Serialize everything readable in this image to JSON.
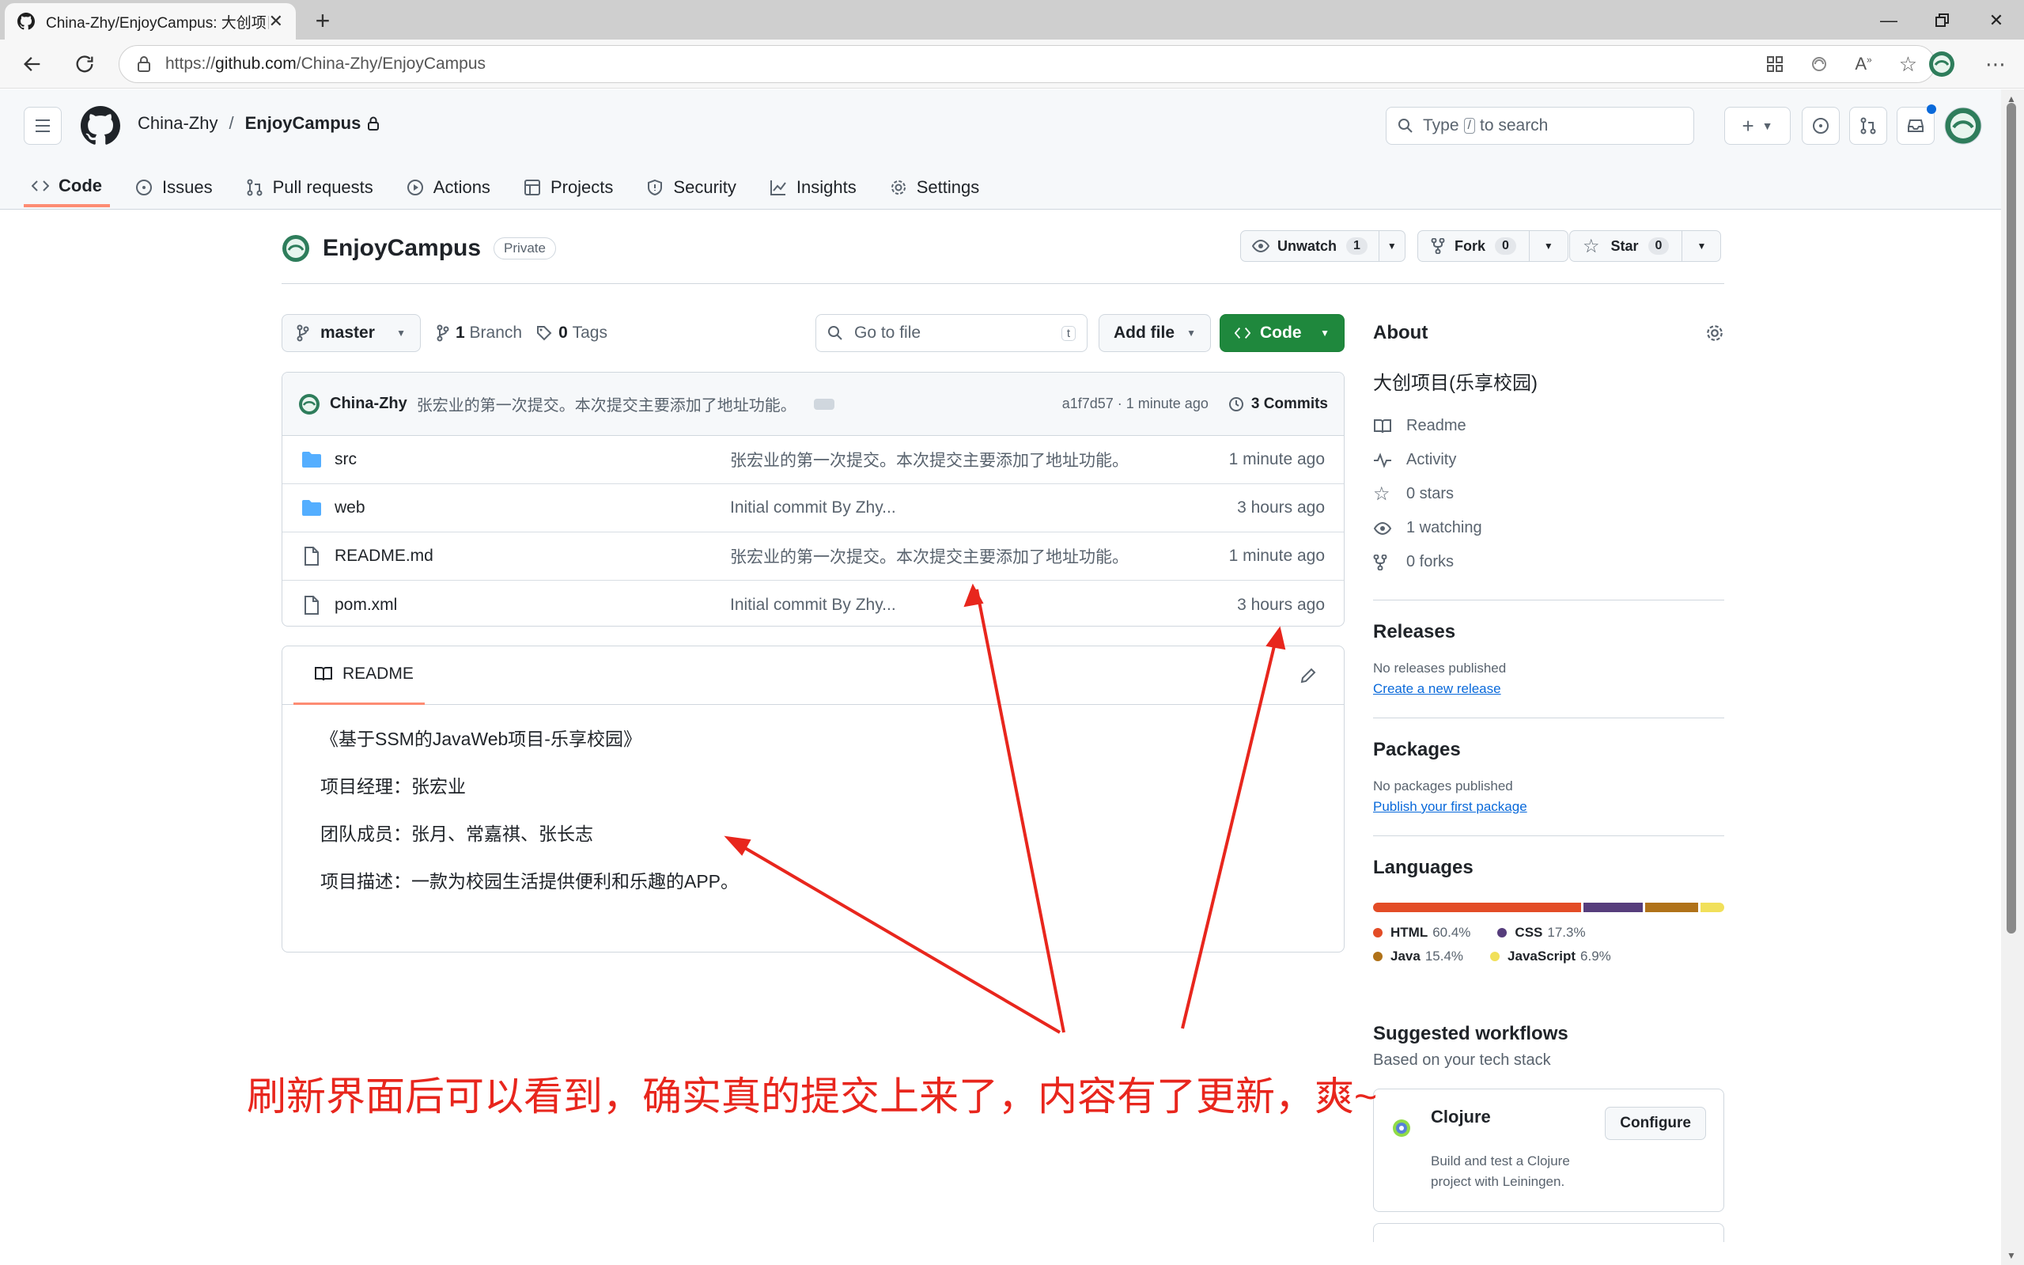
{
  "browser": {
    "tab_title": "China-Zhy/EnjoyCampus: 大创项目",
    "url_prefix": "https://",
    "url_host": "github.com",
    "url_path": "/China-Zhy/EnjoyCampus"
  },
  "header": {
    "owner": "China-Zhy",
    "separator": "/",
    "repo": "EnjoyCampus",
    "search_prefix": "Type",
    "search_key": "/",
    "search_suffix": "to search"
  },
  "nav": [
    {
      "label": "Code",
      "icon": "code-icon",
      "active": true
    },
    {
      "label": "Issues",
      "icon": "issue-icon"
    },
    {
      "label": "Pull requests",
      "icon": "pull-request-icon"
    },
    {
      "label": "Actions",
      "icon": "play-icon"
    },
    {
      "label": "Projects",
      "icon": "table-icon"
    },
    {
      "label": "Security",
      "icon": "shield-icon"
    },
    {
      "label": "Insights",
      "icon": "graph-icon"
    },
    {
      "label": "Settings",
      "icon": "gear-icon"
    }
  ],
  "repo": {
    "name": "EnjoyCampus",
    "visibility": "Private",
    "unwatch_label": "Unwatch",
    "watch_count": "1",
    "fork_label": "Fork",
    "fork_count": "0",
    "star_label": "Star",
    "star_count": "0"
  },
  "toolbar": {
    "branch": "master",
    "branch_count": "1",
    "branch_label": "Branch",
    "tag_count": "0",
    "tag_label": "Tags",
    "goto_placeholder": "Go to file",
    "goto_key": "t",
    "add_file": "Add file",
    "code_button": "Code"
  },
  "commit": {
    "author": "China-Zhy",
    "message": "张宏业的第一次提交。本次提交主要添加了地址功能。",
    "hash_time": "a1f7d57 · 1 minute ago",
    "commits_count": "3",
    "commits_label": "Commits"
  },
  "files": [
    {
      "name": "src",
      "type": "folder",
      "message": "张宏业的第一次提交。本次提交主要添加了地址功能。",
      "time": "1 minute ago"
    },
    {
      "name": "web",
      "type": "folder",
      "message": "Initial commit By Zhy...",
      "time": "3 hours ago"
    },
    {
      "name": "README.md",
      "type": "file",
      "message": "张宏业的第一次提交。本次提交主要添加了地址功能。",
      "time": "1 minute ago"
    },
    {
      "name": "pom.xml",
      "type": "file",
      "message": "Initial commit By Zhy...",
      "time": "3 hours ago"
    }
  ],
  "readme": {
    "tab_label": "README",
    "lines": [
      "《基于SSM的JavaWeb项目-乐享校园》",
      "项目经理：张宏业",
      "团队成员：张月、常嘉祺、张长志",
      "项目描述：一款为校园生活提供便利和乐趣的APP。"
    ]
  },
  "about": {
    "title": "About",
    "description": "大创项目(乐享校园)",
    "items": [
      {
        "label": "Readme",
        "icon": "book-icon"
      },
      {
        "label": "Activity",
        "icon": "pulse-icon"
      },
      {
        "label": "0 stars",
        "icon": "star-icon"
      },
      {
        "label": "1 watching",
        "icon": "eye-icon"
      },
      {
        "label": "0 forks",
        "icon": "fork-icon"
      }
    ]
  },
  "releases": {
    "title": "Releases",
    "empty": "No releases published",
    "link": "Create a new release"
  },
  "packages": {
    "title": "Packages",
    "empty": "No packages published",
    "link": "Publish your first package"
  },
  "languages": {
    "title": "Languages",
    "items": [
      {
        "name": "HTML",
        "percent": "60.4%",
        "value": 60.4,
        "color": "#e34c26"
      },
      {
        "name": "CSS",
        "percent": "17.3%",
        "value": 17.3,
        "color": "#563d7c"
      },
      {
        "name": "Java",
        "percent": "15.4%",
        "value": 15.4,
        "color": "#b07219"
      },
      {
        "name": "JavaScript",
        "percent": "6.9%",
        "value": 6.9,
        "color": "#f1e05a"
      }
    ]
  },
  "workflows": {
    "title": "Suggested workflows",
    "subtitle": "Based on your tech stack",
    "card_title": "Clojure",
    "card_desc": "Build and test a Clojure project with Leiningen.",
    "configure": "Configure"
  },
  "annotation": "刷新界面后可以看到，确实真的提交上来了，内容有了更新，爽~",
  "colors": {
    "accent_green": "#1f883d",
    "link_blue": "#0969da",
    "annotation_red": "#e8261d",
    "active_tab_underline": "#fd8c73"
  }
}
